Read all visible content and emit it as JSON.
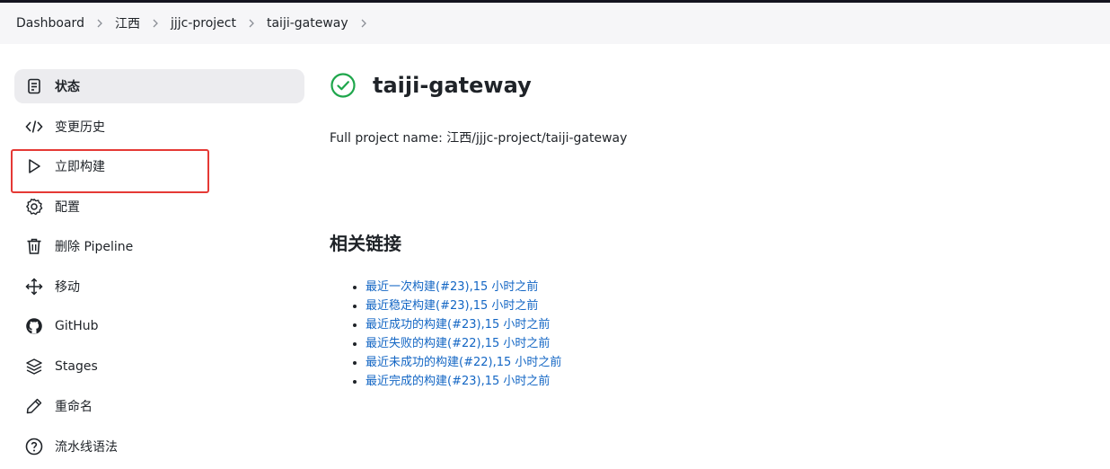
{
  "breadcrumb": [
    "Dashboard",
    "江西",
    "jjjc-project",
    "taiji-gateway"
  ],
  "sidebar": {
    "items": [
      {
        "label": "状态",
        "icon": "document-icon",
        "active": true
      },
      {
        "label": "变更历史",
        "icon": "code-icon"
      },
      {
        "label": "立即构建",
        "icon": "play-icon"
      },
      {
        "label": "配置",
        "icon": "gear-icon"
      },
      {
        "label": "删除 Pipeline",
        "icon": "trash-icon"
      },
      {
        "label": "移动",
        "icon": "move-icon"
      },
      {
        "label": "GitHub",
        "icon": "github-icon"
      },
      {
        "label": "Stages",
        "icon": "layers-icon"
      },
      {
        "label": "重命名",
        "icon": "pencil-icon"
      },
      {
        "label": "流水线语法",
        "icon": "help-icon"
      }
    ]
  },
  "main": {
    "title": "taiji-gateway",
    "status_icon": "success-check-icon",
    "status_color": "#1ea64b",
    "full_name": "Full project name: 江西/jjjc-project/taiji-gateway",
    "permalinks_title": "相关链接",
    "permalinks": [
      "最近一次构建(#23),15 小时之前",
      "最近稳定构建(#23),15 小时之前",
      "最近成功的构建(#23),15 小时之前",
      "最近失败的构建(#22),15 小时之前",
      "最近未成功的构建(#22),15 小时之前",
      "最近完成的构建(#23),15 小时之前"
    ]
  },
  "colors": {
    "link": "#1366c4",
    "highlight": "#e53935",
    "active_bg": "#ececef"
  }
}
